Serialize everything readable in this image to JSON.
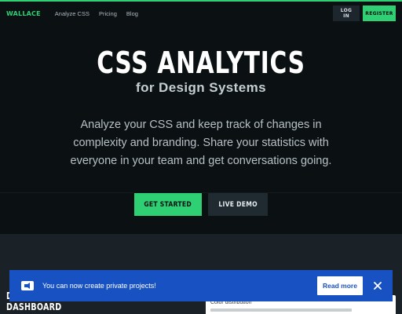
{
  "nav": {
    "logo": "WALLACE",
    "links": [
      "Analyze CSS",
      "Pricing",
      "Blog"
    ],
    "login_label": "LOG IN",
    "register_label": "REGISTER"
  },
  "hero": {
    "title": "CSS ANALYTICS",
    "subtitle": "for Design Systems",
    "description": "Analyze your CSS and keep track of changes in complexity and branding. Share your statistics with everyone in your team and get conversations going.",
    "cta_primary": "GET STARTED",
    "cta_secondary": "LIVE DEMO"
  },
  "preview": {
    "left_heading_line1": "D",
    "left_heading_line2": "DASHBOARD",
    "right_label": "Color distribution"
  },
  "toast": {
    "message": "You can now create private projects!",
    "button_label": "Read more",
    "icon": "megaphone-icon",
    "close_icon": "close-icon"
  },
  "colors": {
    "accent": "#2fcf73",
    "background": "#0b1013",
    "toast": "#1852c2"
  }
}
